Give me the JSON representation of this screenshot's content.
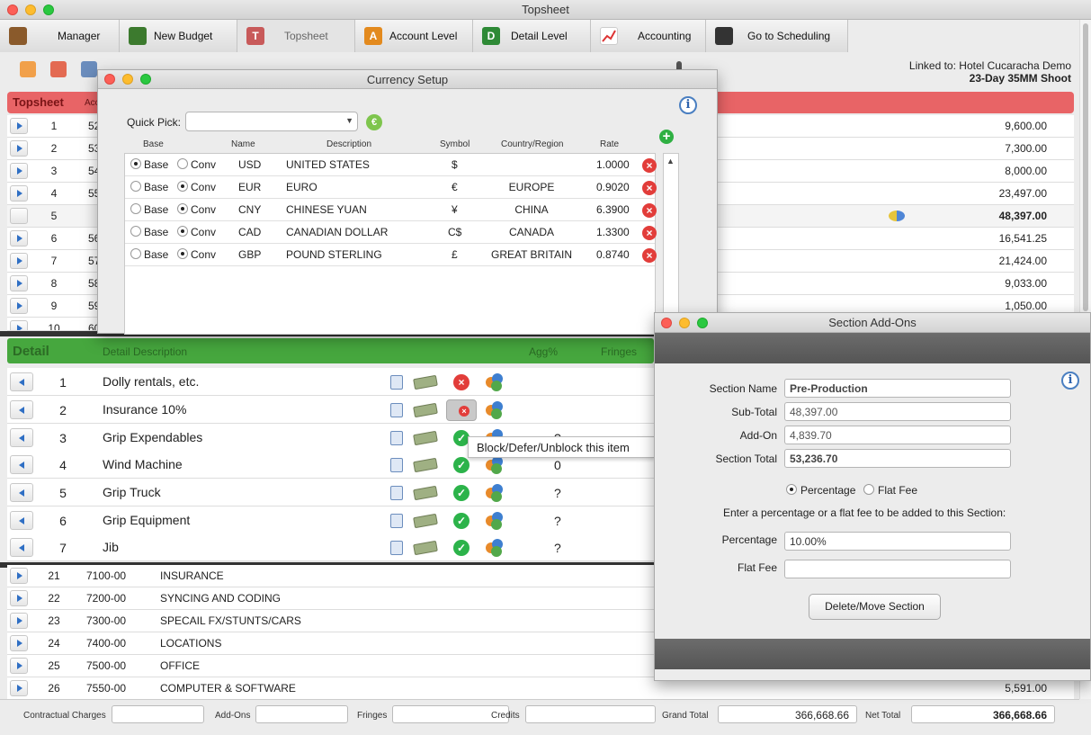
{
  "window": {
    "title": "Topsheet"
  },
  "nav": [
    {
      "label": "Manager",
      "icon": "briefcase-icon",
      "color": "#8a5a2b"
    },
    {
      "label": "New Budget",
      "icon": "new-budget-icon",
      "color": "#3c7a2e"
    },
    {
      "label": "Topsheet",
      "icon": "topsheet-icon",
      "color": "#c85a5a",
      "glyph": "T"
    },
    {
      "label": "Account Level",
      "icon": "account-level-icon",
      "color": "#e38a1e",
      "glyph": "A"
    },
    {
      "label": "Detail Level",
      "icon": "detail-level-icon",
      "color": "#2e8a36",
      "glyph": "D"
    },
    {
      "label": "Accounting",
      "icon": "accounting-chart-icon",
      "color": "#d33"
    },
    {
      "label": "Go to Scheduling",
      "icon": "clapperboard-icon",
      "color": "#333"
    }
  ],
  "linked": {
    "line1": "Linked to: Hotel Cucaracha Demo",
    "line2": "23-Day 35MM Shoot"
  },
  "topsheet": {
    "header": "Topsheet",
    "acct_header": "Acc",
    "rows": [
      {
        "num": "1",
        "acct": "52",
        "value": "9,600.00"
      },
      {
        "num": "2",
        "acct": "53",
        "value": "7,300.00"
      },
      {
        "num": "3",
        "acct": "54",
        "value": "8,000.00"
      },
      {
        "num": "4",
        "acct": "55",
        "value": "23,497.00"
      },
      {
        "num": "5",
        "acct": "",
        "value": "48,397.00"
      },
      {
        "num": "6",
        "acct": "56",
        "value": "16,541.25"
      },
      {
        "num": "7",
        "acct": "57",
        "value": "21,424.00"
      },
      {
        "num": "8",
        "acct": "58",
        "value": "9,033.00"
      },
      {
        "num": "9",
        "acct": "59",
        "value": "1,050.00"
      },
      {
        "num": "10",
        "acct": "60",
        "value": ""
      }
    ],
    "lower_rows": [
      {
        "num": "21",
        "code": "7100-00",
        "desc": "INSURANCE",
        "value": ""
      },
      {
        "num": "22",
        "code": "7200-00",
        "desc": "SYNCING AND CODING",
        "value": ""
      },
      {
        "num": "23",
        "code": "7300-00",
        "desc": "SPECAIL FX/STUNTS/CARS",
        "value": ""
      },
      {
        "num": "24",
        "code": "7400-00",
        "desc": "LOCATIONS",
        "value": ""
      },
      {
        "num": "25",
        "code": "7500-00",
        "desc": "OFFICE",
        "value": ""
      },
      {
        "num": "26",
        "code": "7550-00",
        "desc": "COMPUTER & SOFTWARE",
        "value": "5,591.00"
      }
    ]
  },
  "detail": {
    "header": "Detail",
    "col_desc": "Detail Description",
    "col_agg": "Agg%",
    "col_fringes": "Fringes",
    "rows": [
      {
        "num": "1",
        "desc": "Dolly rentals, etc.",
        "status": "red",
        "agg": ""
      },
      {
        "num": "2",
        "desc": "Insurance 10%",
        "status": "pressed",
        "agg": ""
      },
      {
        "num": "3",
        "desc": "Grip Expendables",
        "status": "green",
        "agg": "?"
      },
      {
        "num": "4",
        "desc": "Wind Machine",
        "status": "green",
        "agg": "0"
      },
      {
        "num": "5",
        "desc": "Grip Truck",
        "status": "green",
        "agg": "?"
      },
      {
        "num": "6",
        "desc": "Grip Equipment",
        "status": "green",
        "agg": "?"
      },
      {
        "num": "7",
        "desc": "Jib",
        "status": "green",
        "agg": "?"
      }
    ],
    "tooltip": "Block/Defer/Unblock this item"
  },
  "footer": {
    "contractual_label": "Contractual Charges",
    "contractual_value": "",
    "addons_label": "Add-Ons",
    "addons_value": "",
    "fringes_label": "Fringes",
    "fringes_value": "",
    "credits_label": "Credits",
    "credits_value": "",
    "grand_label": "Grand Total",
    "grand_value": "366,668.66",
    "net_label": "Net Total",
    "net_value": "366,668.66"
  },
  "currency": {
    "title": "Currency Setup",
    "quick_pick_label": "Quick Pick:",
    "quick_pick_value": "",
    "euro_glyph": "€",
    "add_glyph": "+",
    "headers": {
      "base": "Base",
      "name": "Name",
      "description": "Description",
      "symbol": "Symbol",
      "country": "Country/Region",
      "rate": "Rate"
    },
    "base_label": "Base",
    "conv_label": "Conv",
    "rows": [
      {
        "base_on": true,
        "name": "USD",
        "description": "UNITED STATES",
        "symbol": "$",
        "country": "",
        "rate": "1.0000"
      },
      {
        "base_on": false,
        "name": "EUR",
        "description": "EURO",
        "symbol": "€",
        "country": "EUROPE",
        "rate": "0.9020"
      },
      {
        "base_on": false,
        "name": "CNY",
        "description": "CHINESE YUAN",
        "symbol": "¥",
        "country": "CHINA",
        "rate": "6.3900"
      },
      {
        "base_on": false,
        "name": "CAD",
        "description": "CANADIAN DOLLAR",
        "symbol": "C$",
        "country": "CANADA",
        "rate": "1.3300"
      },
      {
        "base_on": false,
        "name": "GBP",
        "description": "POUND STERLING",
        "symbol": "£",
        "country": "GREAT BRITAIN",
        "rate": "0.8740"
      }
    ]
  },
  "addons": {
    "title": "Section Add-Ons",
    "section_name_label": "Section Name",
    "section_name": "Pre-Production",
    "subtotal_label": "Sub-Total",
    "subtotal": "48,397.00",
    "addon_label": "Add-On",
    "addon": "4,839.70",
    "section_total_label": "Section Total",
    "section_total": "53,236.70",
    "mode_percentage": "Percentage",
    "mode_flat": "Flat Fee",
    "mode_selected": "Percentage",
    "instructions": "Enter a percentage or a flat fee to be added to this Section:",
    "percentage_label": "Percentage",
    "percentage": "10.00%",
    "flat_fee_label": "Flat Fee",
    "flat_fee": "",
    "delete_move_label": "Delete/Move Section"
  },
  "info_glyph": "i"
}
